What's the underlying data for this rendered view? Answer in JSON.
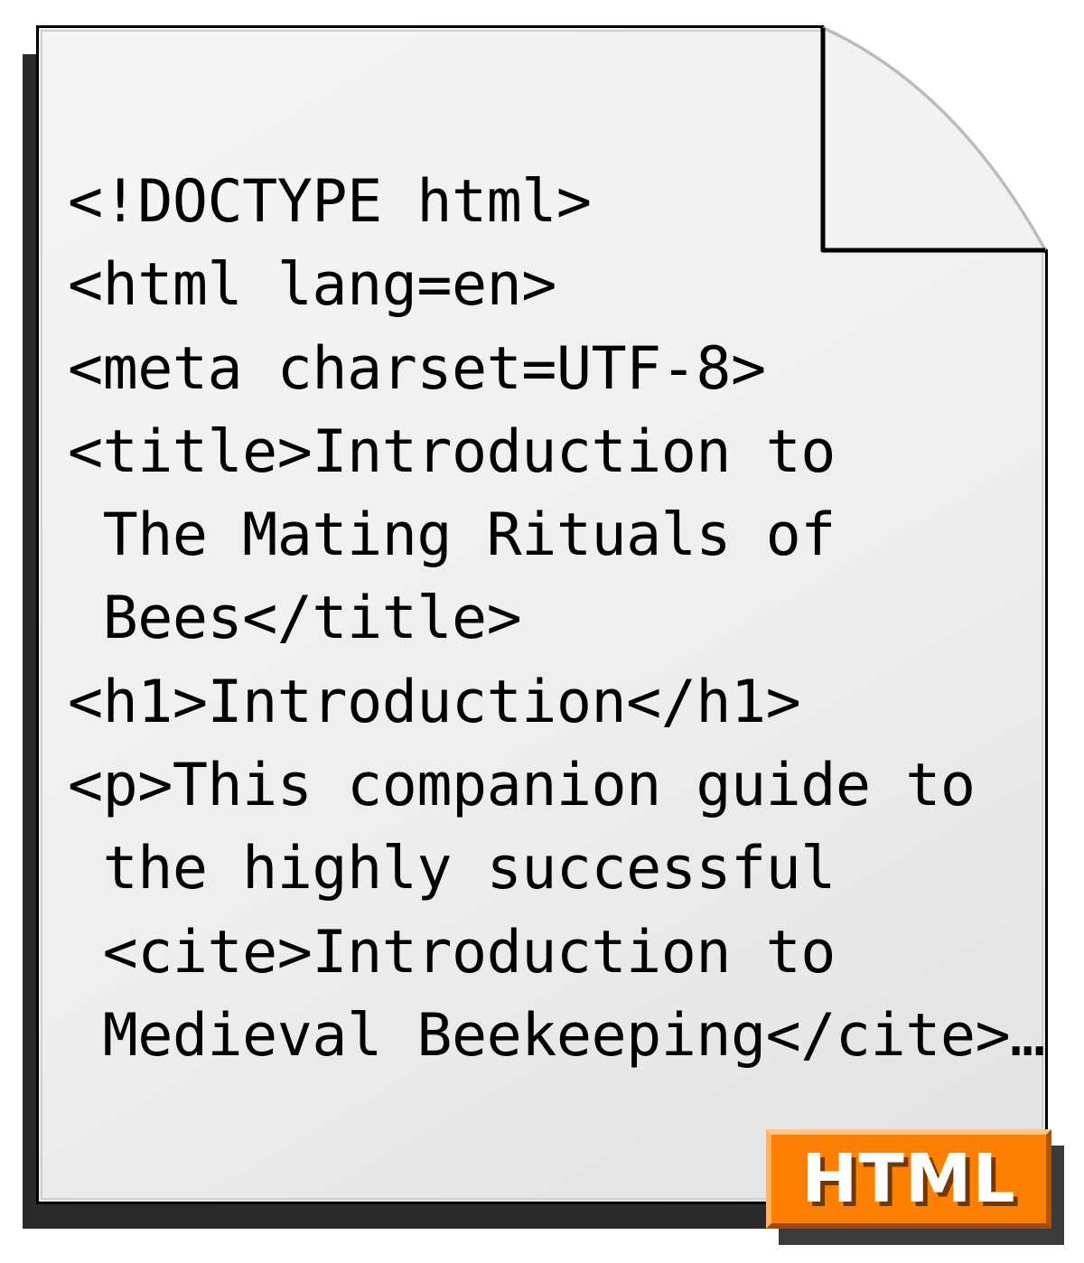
{
  "code_lines": [
    "<!DOCTYPE html>",
    "<html lang=en>",
    "<meta charset=UTF-8>",
    "<title>Introduction to",
    " The Mating Rituals of",
    " Bees</title>",
    "<h1>Introduction</h1>",
    "<p>This companion guide to",
    " the highly successful",
    " <cite>Introduction to",
    " Medieval Beekeeping</cite>…"
  ],
  "badge_label": "HTML"
}
